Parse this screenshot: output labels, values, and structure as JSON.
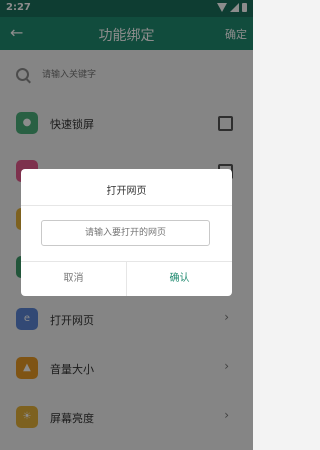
{
  "status": {
    "time": "2:27"
  },
  "toolbar": {
    "title": "功能绑定",
    "confirm": "确定"
  },
  "search": {
    "placeholder": "请输入关键字"
  },
  "items": [
    {
      "label": "快速锁屏",
      "icon_color": "#4caf7a",
      "icon": "lock-icon",
      "control": "checkbox"
    },
    {
      "label": "",
      "icon_color": "#e35a8c",
      "icon": "app-icon",
      "control": "checkbox"
    },
    {
      "label": "",
      "icon_color": "#e4b13a",
      "icon": "app-icon",
      "control": "none"
    },
    {
      "label": "",
      "icon_color": "#3f9c6a",
      "icon": "app-icon",
      "control": "none"
    },
    {
      "label": "打开网页",
      "icon_color": "#5b86d6",
      "icon": "browser-icon",
      "control": "chevron"
    },
    {
      "label": "音量大小",
      "icon_color": "#e89a25",
      "icon": "volume-icon",
      "control": "chevron"
    },
    {
      "label": "屏幕亮度",
      "icon_color": "#e4b13a",
      "icon": "brightness-icon",
      "control": "chevron"
    }
  ],
  "dialog": {
    "title": "打开网页",
    "input_placeholder": "请输入要打开的网页",
    "cancel": "取消",
    "confirm": "确认"
  },
  "colors": {
    "primary": "#1f8a6f",
    "status": "#1b6f5b"
  }
}
